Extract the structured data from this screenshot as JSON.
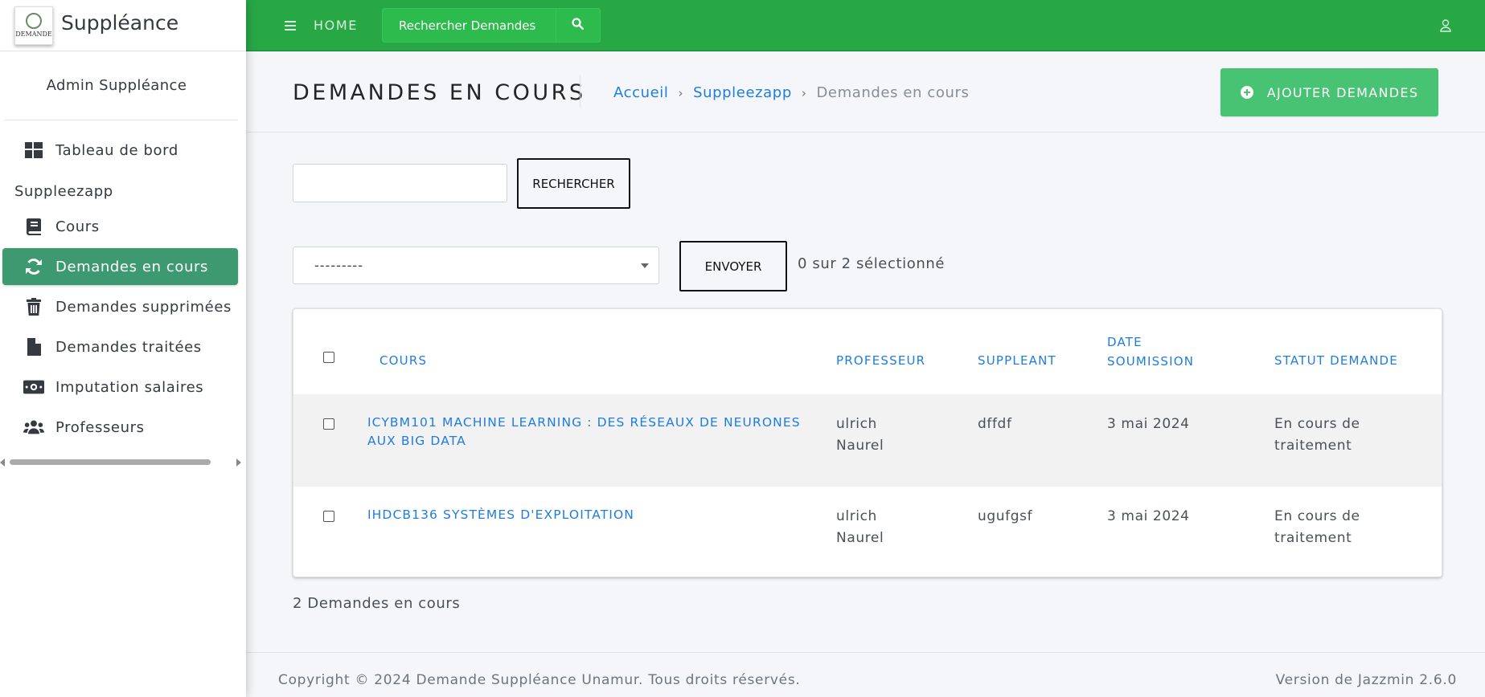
{
  "brand": {
    "name": "Suppléance",
    "logo_text": "DEMANDE"
  },
  "user": {
    "name": "Admin Suppléance"
  },
  "sidebar": {
    "items": [
      {
        "label": "Tableau de bord",
        "icon": "dashboard-icon"
      },
      {
        "header": "Suppleezapp"
      },
      {
        "label": "Cours",
        "icon": "book-icon"
      },
      {
        "label": "Demandes en cours",
        "icon": "sync-icon",
        "active": true
      },
      {
        "label": "Demandes supprimées",
        "icon": "trash-icon"
      },
      {
        "label": "Demandes traitées",
        "icon": "file-icon"
      },
      {
        "label": "Imputation salaires",
        "icon": "money-icon"
      },
      {
        "label": "Professeurs",
        "icon": "users-icon"
      }
    ]
  },
  "topbar": {
    "home_label": "HOME",
    "search_placeholder": "Rechercher Demandes",
    "bg_color": "#28a745"
  },
  "header": {
    "title": "DEMANDES EN COURS",
    "breadcrumb": [
      "Accueil",
      "Suppleezapp",
      "Demandes en cours"
    ],
    "add_button": "AJOUTER DEMANDES"
  },
  "search": {
    "value": "",
    "button": "RECHERCHER"
  },
  "actions": {
    "select_value": "---------",
    "button": "ENVOYER",
    "selected_count": "0 sur 2 sélectionné"
  },
  "table": {
    "headers": {
      "cours": "COURS",
      "professeur": "PROFESSEUR",
      "suppleant": "SUPPLEANT",
      "date_1": "DATE",
      "date_2": "SOUMISSION",
      "statut": "STATUT DEMANDE"
    },
    "rows": [
      {
        "cours_1": "ICYBM101 MACHINE LEARNING : DES RÉSEAUX DE NEURONES",
        "cours_2": "AUX BIG DATA",
        "prof_1": "ulrich",
        "prof_2": "Naurel",
        "suppleant": "dffdf",
        "date": "3 mai 2024",
        "statut_1": "En cours de",
        "statut_2": "traitement"
      },
      {
        "cours_1": "IHDCB136 SYSTÈMES D'EXPLOITATION",
        "cours_2": "",
        "prof_1": "ulrich",
        "prof_2": "Naurel",
        "suppleant": "ugufgsf",
        "date": "3 mai 2024",
        "statut_1": "En cours de",
        "statut_2": "traitement"
      }
    ]
  },
  "total": "2 Demandes en cours",
  "footer": {
    "copyright": "Copyright © 2024 Demande Suppléance Unamur. Tous droits réservés.",
    "version": "Version de Jazzmin 2.6.0"
  },
  "colors": {
    "accent": "#28a745",
    "active_nav": "#3d9970",
    "link": "#1f7de0",
    "add_button": "#48c373"
  }
}
